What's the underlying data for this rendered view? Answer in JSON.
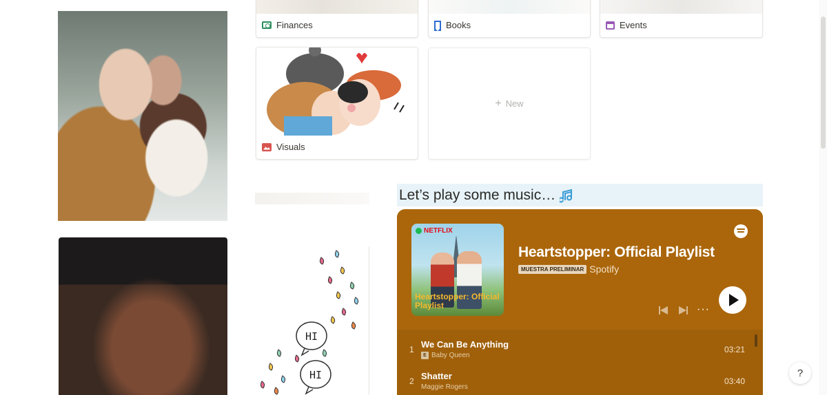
{
  "gallery": {
    "cards": [
      {
        "label": "Finances",
        "icon": "money-icon"
      },
      {
        "label": "Books",
        "icon": "bookmark-icon"
      },
      {
        "label": "Events",
        "icon": "calendar-icon"
      },
      {
        "label": "Visuals",
        "icon": "image-icon"
      }
    ],
    "new_label": "New",
    "new_icon": "plus-icon"
  },
  "doodle": {
    "bubble1": "HI",
    "bubble2": "HI"
  },
  "music": {
    "heading": "Let’s play some music…",
    "heading_icon": "music-notes-icon"
  },
  "spotify": {
    "cover_brand": "NETFLIX",
    "cover_title": "Heartstopper: Official Playlist",
    "title": "Heartstopper: Official Playlist",
    "badge": "MUESTRA PRELIMINAR",
    "artist": "Spotify",
    "more": "···",
    "tracks": [
      {
        "num": "1",
        "name": "We Can Be Anything",
        "explicit": "E",
        "artist": "Baby Queen",
        "duration": "03:21"
      },
      {
        "num": "2",
        "name": "Shatter",
        "artist": "Maggie Rogers",
        "duration": "03:40"
      }
    ],
    "colors": {
      "background": "#ab660b",
      "track_list": "#a0600a"
    }
  },
  "help": {
    "label": "?"
  },
  "colors": {
    "heading_bg": "#e7f3f8"
  }
}
